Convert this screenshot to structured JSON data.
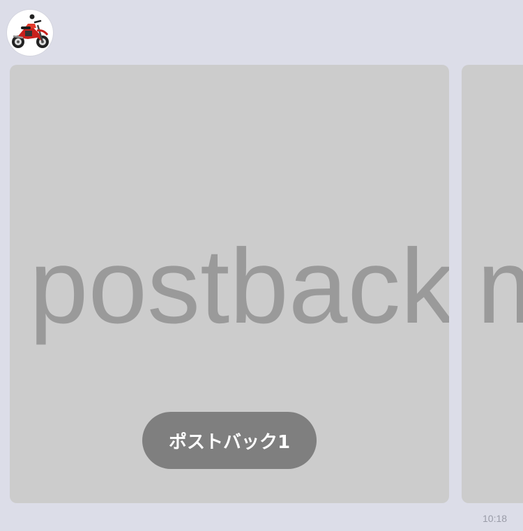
{
  "avatar": {
    "icon": "motorcycle-icon"
  },
  "carousel": {
    "cards": [
      {
        "hero_text": "postback",
        "button_label": "ポストバック1"
      },
      {
        "hero_text": "m"
      }
    ]
  },
  "message": {
    "time": "10:18"
  },
  "colors": {
    "background": "#dcdde8",
    "card": "#cccccc",
    "hero_text": "#9a9a9a",
    "button": "#7f7f7f",
    "button_text": "#ffffff",
    "timestamp": "#9a9ca8"
  }
}
